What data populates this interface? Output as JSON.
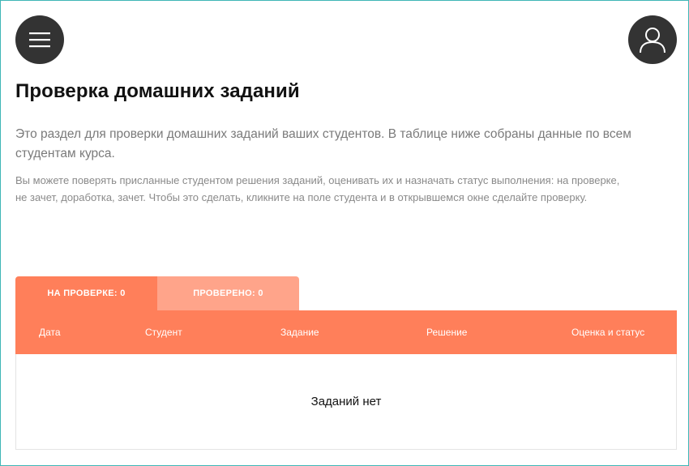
{
  "header": {
    "menu_icon": "hamburger-menu-icon",
    "profile_icon": "user-profile-icon"
  },
  "page": {
    "title": "Проверка домашних заданий",
    "lead": "Это раздел для проверки домашних заданий ваших студентов. В таблице ниже собраны данные по всем студентам курса.",
    "note": "Вы можете поверять присланные студентом решения заданий, оценивать их и назначать статус выполнения: на проверке, не зачет, доработка, зачет. Чтобы это сделать, кликните на поле студента и в открывшемся окне сделайте проверку."
  },
  "tabs": [
    {
      "label": "НА ПРОВЕРКЕ: 0",
      "active": true
    },
    {
      "label": "ПРОВЕРЕНО: 0",
      "active": false
    }
  ],
  "table": {
    "columns": [
      "Дата",
      "Студент",
      "Задание",
      "Решение",
      "Оценка и статус"
    ],
    "empty_text": "Заданий нет"
  },
  "colors": {
    "accent": "#ff7f5a",
    "accent_light": "#ffa48a",
    "button_dark": "#333333",
    "frame": "#3fb6b6"
  }
}
